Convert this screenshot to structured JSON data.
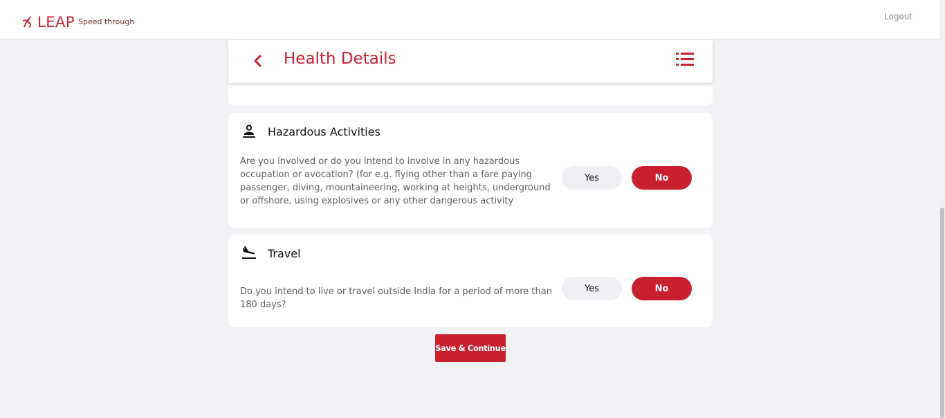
{
  "topbar": {
    "logo_text": "LEAP",
    "tagline": "Speed through",
    "logout_label": "Logout"
  },
  "header": {
    "title": "Health Details",
    "back_icon": "chevron-left-icon",
    "menu_icon": "list-menu-icon"
  },
  "sections": {
    "hazardous": {
      "title": "Hazardous Activities",
      "icon": "person-activity-icon",
      "question": "Are you involved or do you intend to involve in any hazardous occupation or avocation? (for e.g. flying other than a fare paying passenger, diving, mountaineering, working at heights, underground or offshore, using explosives or any other dangerous activity",
      "yes_label": "Yes",
      "no_label": "No",
      "selected": "No"
    },
    "travel": {
      "title": "Travel",
      "icon": "airplane-landing-icon",
      "question": "Do you intend to live or travel outside India for a period of more than 180 days?",
      "yes_label": "Yes",
      "no_label": "No",
      "selected": "No"
    }
  },
  "actions": {
    "save_label": "Save & Continue"
  },
  "colors": {
    "brand": "#c8202f",
    "background": "#f1f2f6",
    "pill_inactive": "#eef0f4"
  }
}
